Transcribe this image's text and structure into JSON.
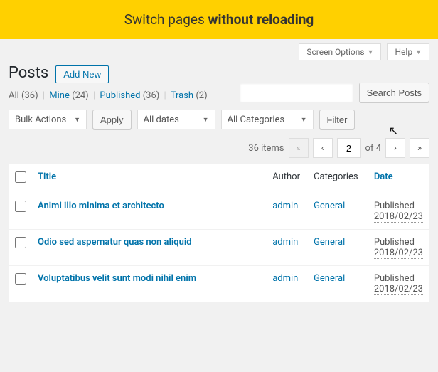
{
  "banner": {
    "prefix": "Switch pages ",
    "bold": "without reloading"
  },
  "top": {
    "screen_options": "Screen Options",
    "help": "Help"
  },
  "header": {
    "title": "Posts",
    "add_new": "Add New"
  },
  "views": {
    "all_label": "All",
    "all_count": "(36)",
    "mine_label": "Mine",
    "mine_count": "(24)",
    "published_label": "Published",
    "published_count": "(36)",
    "trash_label": "Trash",
    "trash_count": "(2)"
  },
  "search": {
    "button": "Search Posts"
  },
  "filters": {
    "bulk": "Bulk Actions",
    "apply": "Apply",
    "dates": "All dates",
    "cats": "All Categories",
    "filter": "Filter"
  },
  "nav": {
    "items": "36 items",
    "first": "«",
    "prev": "‹",
    "current": "2",
    "of": "of 4",
    "next": "›",
    "last": "»"
  },
  "cols": {
    "title": "Title",
    "author": "Author",
    "categories": "Categories",
    "date": "Date"
  },
  "rows": [
    {
      "title": "Animi illo minima et architecto",
      "author": "admin",
      "category": "General",
      "status": "Published",
      "date": "2018/02/23"
    },
    {
      "title": "Odio sed aspernatur quas non aliquid",
      "author": "admin",
      "category": "General",
      "status": "Published",
      "date": "2018/02/23"
    },
    {
      "title": "Voluptatibus velit sunt modi nihil enim",
      "author": "admin",
      "category": "General",
      "status": "Published",
      "date": "2018/02/23"
    }
  ]
}
